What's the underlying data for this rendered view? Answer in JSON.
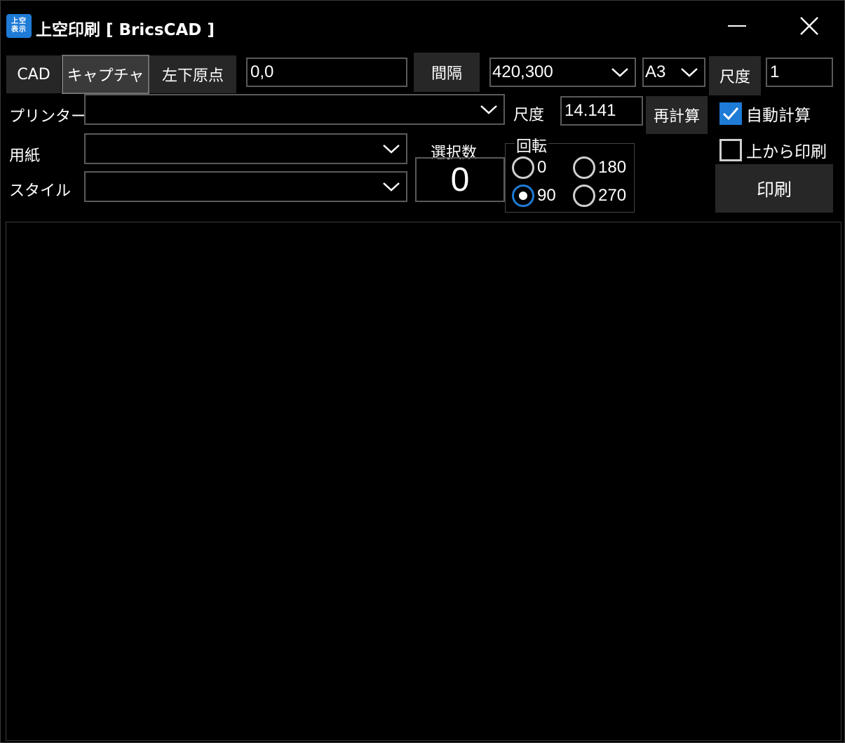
{
  "window": {
    "icon_lines": [
      "上空",
      "表示"
    ],
    "title": "上空印刷 [ BricsCAD ]"
  },
  "toolbar": {
    "cad_label": "CAD",
    "capture_label": "キャプチャ",
    "origin_label": "左下原点",
    "origin_value": "0,0",
    "spacing_label": "間隔",
    "spacing_value": "420,300",
    "paper_size_value": "A3",
    "scale_button_label": "尺度",
    "scale_value": "1"
  },
  "printer": {
    "label": "プリンター",
    "value": ""
  },
  "paper": {
    "label": "用紙",
    "value": ""
  },
  "style": {
    "label": "スタイル",
    "value": ""
  },
  "calc": {
    "scale_label": "尺度",
    "scale_value": "14.141",
    "recalc_label": "再計算"
  },
  "selection": {
    "label": "選択数",
    "count": "0"
  },
  "rotation": {
    "label": "回転",
    "options": [
      {
        "label": "0",
        "selected": false
      },
      {
        "label": "180",
        "selected": false
      },
      {
        "label": "90",
        "selected": true
      },
      {
        "label": "270",
        "selected": false
      }
    ]
  },
  "options": {
    "auto_calc_label": "自動計算",
    "auto_calc_checked": true,
    "print_from_top_label": "上から印刷",
    "print_from_top_checked": false
  },
  "print_button_label": "印刷",
  "colors": {
    "accent": "#1e7bd6",
    "button_bg": "#272727",
    "border": "#5a5a5a"
  }
}
